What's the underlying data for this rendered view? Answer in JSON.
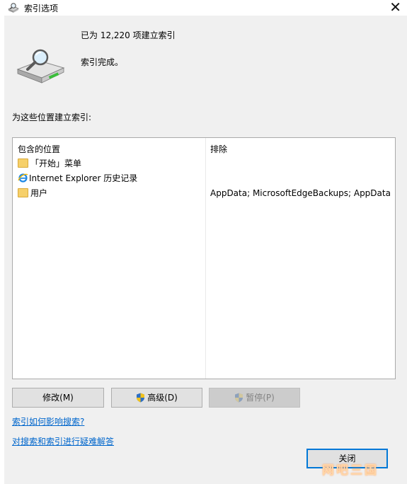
{
  "window": {
    "title": "索引选项",
    "close_glyph": "✕"
  },
  "status": {
    "count_text": "已为 12,220 项建立索引",
    "complete_text": "索引完成。"
  },
  "locations": {
    "section_label": "为这些位置建立索引:",
    "header_included": "包含的位置",
    "header_excluded": "排除",
    "rows": [
      {
        "icon": "folder-icon",
        "name": "「开始」菜单",
        "exclude": ""
      },
      {
        "icon": "ie-icon",
        "name": "Internet Explorer 历史记录",
        "exclude": ""
      },
      {
        "icon": "folder-icon",
        "name": "用户",
        "exclude": "AppData; MicrosoftEdgeBackups; AppData"
      }
    ]
  },
  "buttons": {
    "modify": "修改(M)",
    "advanced": "高级(D)",
    "pause": "暂停(P)",
    "close": "关闭"
  },
  "links": {
    "how_affects": "索引如何影响搜索?",
    "troubleshoot": "对搜索和索引进行疑难解答"
  },
  "watermark": "网吧三国",
  "colors": {
    "link": "#0066cc",
    "focus_border": "#0078d7",
    "folder": "#f6d06a"
  }
}
